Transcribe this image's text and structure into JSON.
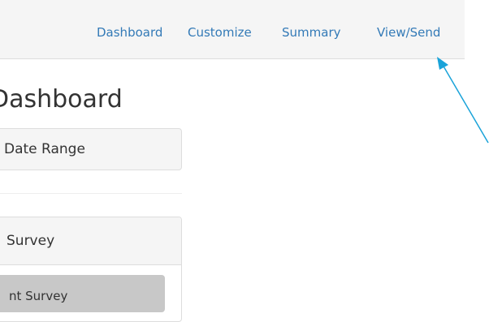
{
  "nav": {
    "items": [
      {
        "label": "Dashboard"
      },
      {
        "label": "Customize"
      },
      {
        "label": "Summary"
      },
      {
        "label": "View/Send"
      }
    ]
  },
  "page": {
    "title": "Dashboard"
  },
  "date_range": {
    "label": "Date Range"
  },
  "survey_panel": {
    "label": "Survey",
    "items": [
      {
        "label": "nt Survey"
      }
    ]
  },
  "annotation": {
    "color": "#1aa3d9",
    "icon": "arrow-pointer-icon"
  }
}
